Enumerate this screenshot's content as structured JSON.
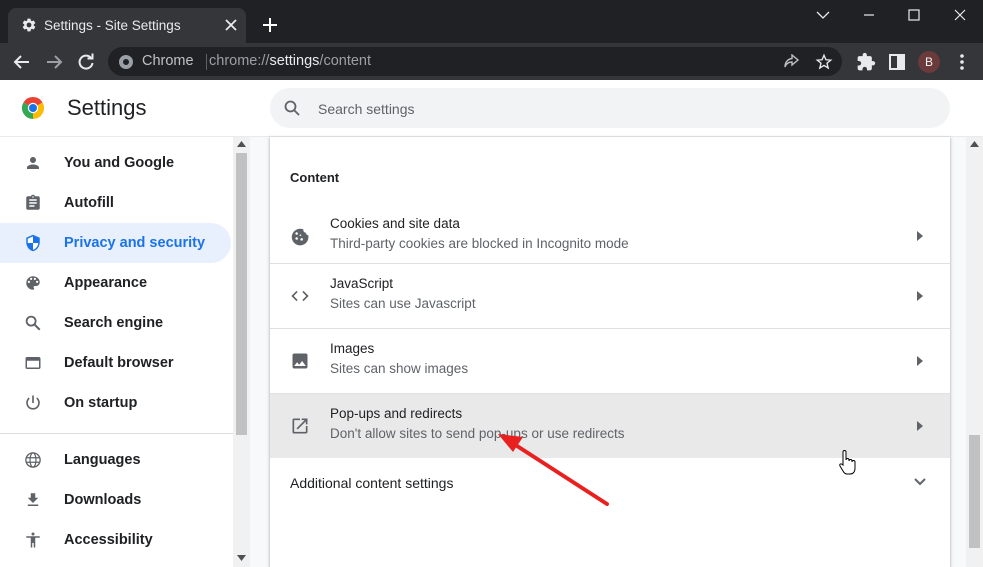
{
  "colors": {
    "accent": "#1a73e8",
    "annotation_arrow": "#e8201f"
  },
  "browser": {
    "tab": {
      "title": "Settings - Site Settings",
      "icon": "gear-icon"
    },
    "omnibox": {
      "chip": "Chrome",
      "url_prefix": "chrome://",
      "url_host": "settings",
      "url_path": "/content"
    },
    "profile_initial": "B"
  },
  "header": {
    "title": "Settings",
    "search_placeholder": "Search settings"
  },
  "sidebar": {
    "items": [
      {
        "label": "You and Google",
        "icon": "person-icon",
        "active": false
      },
      {
        "label": "Autofill",
        "icon": "clipboard-icon",
        "active": false
      },
      {
        "label": "Privacy and security",
        "icon": "shield-icon",
        "active": true
      },
      {
        "label": "Appearance",
        "icon": "palette-icon",
        "active": false
      },
      {
        "label": "Search engine",
        "icon": "search-icon",
        "active": false
      },
      {
        "label": "Default browser",
        "icon": "browser-window-icon",
        "active": false
      },
      {
        "label": "On startup",
        "icon": "power-icon",
        "active": false
      },
      {
        "label": "Languages",
        "icon": "globe-icon",
        "active": false
      },
      {
        "label": "Downloads",
        "icon": "download-icon",
        "active": false
      },
      {
        "label": "Accessibility",
        "icon": "accessibility-icon",
        "active": false
      }
    ]
  },
  "content": {
    "section_title": "Content",
    "rows": [
      {
        "title": "Cookies and site data",
        "subtitle": "Third-party cookies are blocked in Incognito mode",
        "icon": "cookie-icon"
      },
      {
        "title": "JavaScript",
        "subtitle": "Sites can use Javascript",
        "icon": "code-icon"
      },
      {
        "title": "Images",
        "subtitle": "Sites can show images",
        "icon": "image-icon"
      },
      {
        "title": "Pop-ups and redirects",
        "subtitle": "Don't allow sites to send pop-ups or use redirects",
        "icon": "open-in-new-icon",
        "hovered": true
      }
    ],
    "additional_label": "Additional content settings"
  }
}
